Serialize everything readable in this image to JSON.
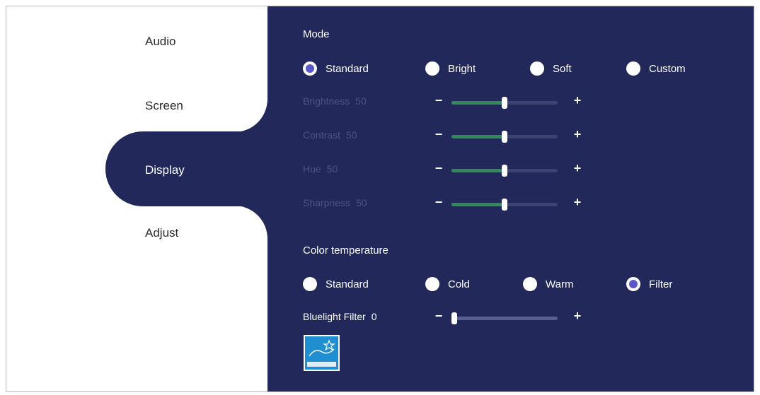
{
  "menu": {
    "items": [
      {
        "label": "Audio"
      },
      {
        "label": "Screen"
      },
      {
        "label": "Display",
        "selected": true
      },
      {
        "label": "Adjust"
      }
    ]
  },
  "mode": {
    "title": "Mode",
    "options": [
      "Standard",
      "Bright",
      "Soft",
      "Custom"
    ],
    "selected": "Standard"
  },
  "sliders": [
    {
      "label": "Brightness",
      "value": "50",
      "level": 50
    },
    {
      "label": "Contrast",
      "value": "50",
      "level": 50
    },
    {
      "label": "Hue",
      "value": "50",
      "level": 50
    },
    {
      "label": "Sharpness",
      "value": "50",
      "level": 50
    }
  ],
  "color_temperature": {
    "title": "Color temperature",
    "options": [
      "Standard",
      "Cold",
      "Warm",
      "Filter"
    ],
    "selected": "Filter"
  },
  "bluelight": {
    "label": "Bluelight Filter",
    "value": "0",
    "level": 0
  },
  "controls": {
    "minus": "−",
    "plus": "+"
  },
  "colors": {
    "panel": "#22285a",
    "accent_radio": "#5b58c8",
    "slider_fill": "#2f8a58",
    "disabled_text": "#4c5288"
  },
  "badge": {
    "icon": "energy-star-icon"
  }
}
